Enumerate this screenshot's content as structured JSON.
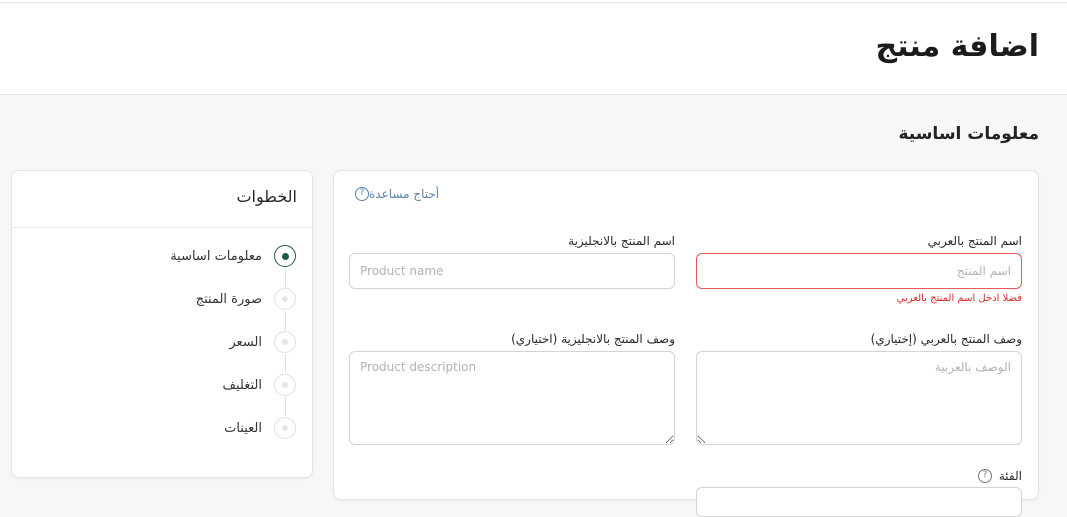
{
  "header": {
    "title": "اضافة منتج"
  },
  "section": {
    "title": "معلومات اساسية"
  },
  "steps": {
    "title": "الخطوات",
    "items": [
      {
        "label": "معلومات اساسية",
        "active": true
      },
      {
        "label": "صورة المنتج",
        "active": false
      },
      {
        "label": "السعر",
        "active": false
      },
      {
        "label": "التغليف",
        "active": false
      },
      {
        "label": "العينات",
        "active": false
      }
    ]
  },
  "form": {
    "help_link": "أحتاج مساعدة",
    "help_icon": "question-circle-icon",
    "name_ar": {
      "label": "اسم المنتج بالعربي",
      "placeholder": "اسم المنتج",
      "value": "",
      "error": "فضلا ادخل اسم المنتج بالعربي"
    },
    "name_en": {
      "label": "اسم المنتج بالانجليزية",
      "placeholder": "Product name",
      "value": ""
    },
    "desc_ar": {
      "label": "وصف المنتج بالعربي (إختياري)",
      "placeholder": "الوصف بالعربية",
      "value": ""
    },
    "desc_en": {
      "label": "وصف المنتج بالانجليزية (اختياري)",
      "placeholder": "Product description",
      "value": ""
    },
    "category": {
      "label": "الفئة"
    }
  },
  "colors": {
    "accent": "#1e5b3f",
    "link": "#5b83a9",
    "error": "#d42b2b"
  }
}
